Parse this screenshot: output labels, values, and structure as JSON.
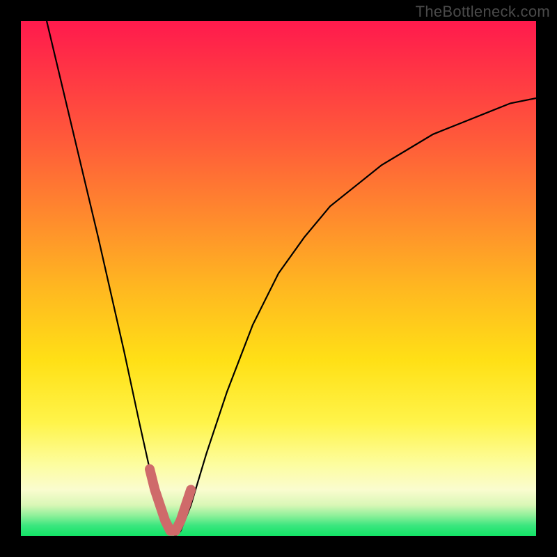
{
  "watermark": "TheBottleneck.com",
  "chart_data": {
    "type": "line",
    "title": "",
    "xlabel": "",
    "ylabel": "",
    "xlim": [
      0,
      100
    ],
    "ylim": [
      0,
      100
    ],
    "background_gradient": {
      "top": "#ff1a4d",
      "bottom": "#12e366",
      "meaning": "red = high bottleneck, green = low bottleneck"
    },
    "series": [
      {
        "name": "bottleneck-curve",
        "stroke": "#000000",
        "x": [
          5,
          10,
          15,
          20,
          23,
          25,
          27,
          29,
          30,
          31,
          33,
          36,
          40,
          45,
          50,
          55,
          60,
          65,
          70,
          75,
          80,
          85,
          90,
          95,
          100
        ],
        "y": [
          100,
          79,
          58,
          36,
          22,
          13,
          6,
          1,
          0,
          1,
          6,
          16,
          28,
          41,
          51,
          58,
          64,
          68,
          72,
          75,
          78,
          80,
          82,
          84,
          85
        ]
      },
      {
        "name": "optimal-band-marker",
        "stroke": "#d66a6a",
        "x": [
          25,
          26,
          27,
          28,
          29,
          30,
          31,
          32,
          33
        ],
        "y": [
          13,
          9,
          6,
          3,
          1,
          1,
          3,
          6,
          9
        ]
      }
    ],
    "annotations": []
  }
}
